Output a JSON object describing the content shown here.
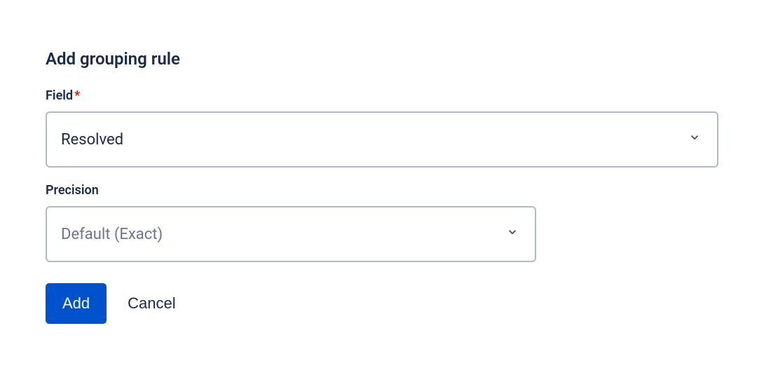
{
  "form": {
    "title": "Add grouping rule",
    "field": {
      "label": "Field",
      "required_marker": "*",
      "selected": "Resolved"
    },
    "precision": {
      "label": "Precision",
      "placeholder": "Default (Exact)"
    },
    "actions": {
      "submit": "Add",
      "cancel": "Cancel"
    }
  }
}
